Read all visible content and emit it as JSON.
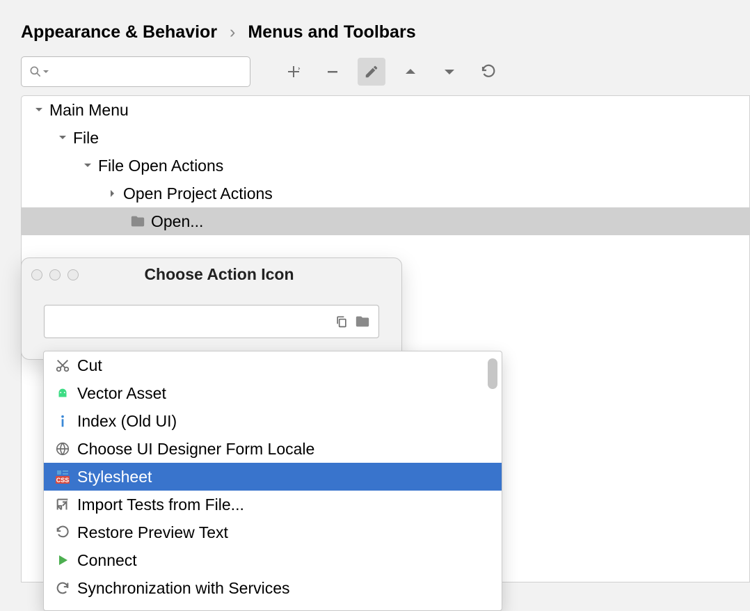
{
  "breadcrumb": {
    "parent": "Appearance & Behavior",
    "current": "Menus and Toolbars"
  },
  "search": {
    "placeholder": ""
  },
  "tree": {
    "root": "Main Menu",
    "l1": "File",
    "l2": "File Open Actions",
    "l3a": "Open Project Actions",
    "l3b": "Open..."
  },
  "dialog": {
    "title": "Choose Action Icon",
    "input_value": ""
  },
  "dropdown": {
    "items": [
      {
        "label": "Cut",
        "icon": "cut"
      },
      {
        "label": "Vector Asset",
        "icon": "android"
      },
      {
        "label": "Index (Old UI)",
        "icon": "info"
      },
      {
        "label": "Choose UI Designer Form Locale",
        "icon": "globe"
      },
      {
        "label": "Stylesheet",
        "icon": "css",
        "selected": true
      },
      {
        "label": "Import Tests from File...",
        "icon": "import"
      },
      {
        "label": "Restore Preview Text",
        "icon": "undo"
      },
      {
        "label": "Connect",
        "icon": "play"
      },
      {
        "label": "Synchronization with Services",
        "icon": "sync"
      }
    ]
  },
  "colors": {
    "selection": "#3974cc"
  }
}
